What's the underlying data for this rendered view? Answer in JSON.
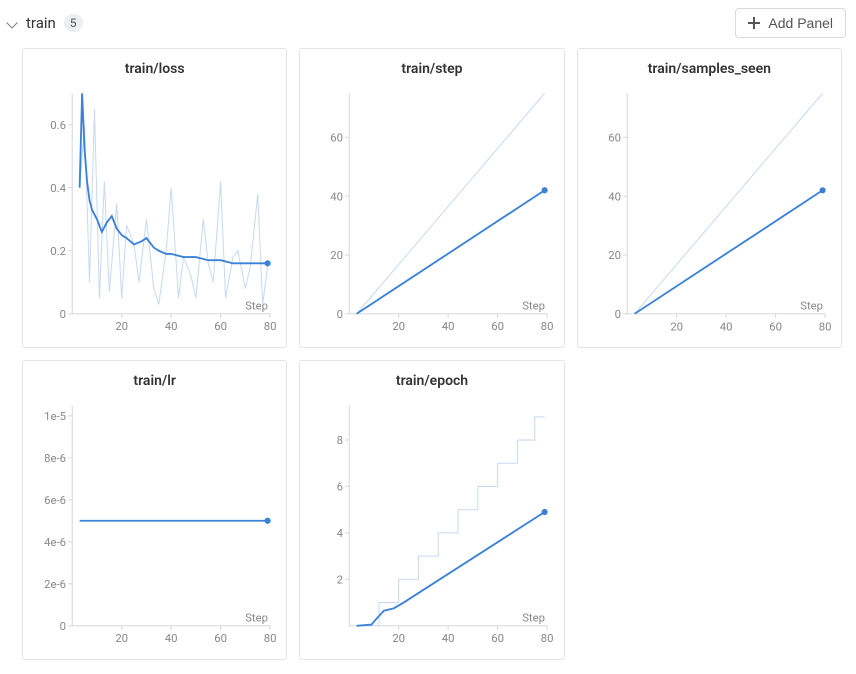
{
  "section": {
    "title": "train",
    "count": "5",
    "add_panel_label": "Add Panel"
  },
  "panels": [
    {
      "title": "train/loss"
    },
    {
      "title": "train/step"
    },
    {
      "title": "train/samples_seen"
    },
    {
      "title": "train/lr"
    },
    {
      "title": "train/epoch"
    }
  ],
  "chart_data": [
    {
      "type": "line",
      "title": "train/loss",
      "xlabel": "Step",
      "ylabel": "",
      "xlim": [
        0,
        80
      ],
      "ylim": [
        0,
        0.7
      ],
      "x_ticks": [
        20,
        40,
        60,
        80
      ],
      "y_ticks": [
        0,
        0.2,
        0.4,
        0.6
      ],
      "series": [
        {
          "name": "raw",
          "role": "ghost",
          "x": [
            3,
            5,
            7,
            9,
            11,
            13,
            15,
            18,
            20,
            22,
            25,
            27,
            30,
            33,
            35,
            38,
            40,
            43,
            45,
            48,
            50,
            53,
            55,
            57,
            60,
            62,
            65,
            67,
            70,
            72,
            75,
            77,
            79
          ],
          "values": [
            0.4,
            0.6,
            0.1,
            0.65,
            0.05,
            0.42,
            0.07,
            0.35,
            0.05,
            0.28,
            0.22,
            0.1,
            0.3,
            0.08,
            0.03,
            0.2,
            0.4,
            0.05,
            0.18,
            0.12,
            0.05,
            0.3,
            0.16,
            0.1,
            0.42,
            0.05,
            0.18,
            0.2,
            0.08,
            0.15,
            0.38,
            0.03,
            0.15
          ]
        },
        {
          "name": "smoothed",
          "role": "main",
          "x": [
            3,
            4,
            5,
            6,
            7,
            8,
            10,
            12,
            14,
            16,
            18,
            20,
            22,
            25,
            28,
            30,
            33,
            35,
            38,
            40,
            45,
            50,
            55,
            60,
            65,
            70,
            75,
            79
          ],
          "values": [
            0.4,
            0.7,
            0.52,
            0.42,
            0.36,
            0.33,
            0.3,
            0.26,
            0.29,
            0.31,
            0.27,
            0.25,
            0.24,
            0.22,
            0.23,
            0.24,
            0.21,
            0.2,
            0.19,
            0.19,
            0.18,
            0.18,
            0.17,
            0.17,
            0.16,
            0.16,
            0.16,
            0.16
          ]
        }
      ]
    },
    {
      "type": "line",
      "title": "train/step",
      "xlabel": "Step",
      "ylabel": "",
      "xlim": [
        0,
        80
      ],
      "ylim": [
        0,
        75
      ],
      "x_ticks": [
        20,
        40,
        60,
        80
      ],
      "y_ticks": [
        0,
        20,
        40,
        60
      ],
      "series": [
        {
          "name": "ghost",
          "role": "ghost",
          "x": [
            3,
            79
          ],
          "values": [
            0,
            75
          ]
        },
        {
          "name": "main",
          "role": "main",
          "x": [
            3,
            79
          ],
          "values": [
            0,
            42
          ]
        }
      ]
    },
    {
      "type": "line",
      "title": "train/samples_seen",
      "xlabel": "Step",
      "ylabel": "",
      "xlim": [
        0,
        80
      ],
      "ylim": [
        0,
        75
      ],
      "x_ticks": [
        20,
        40,
        60,
        80
      ],
      "y_ticks": [
        0,
        20,
        40,
        60
      ],
      "series": [
        {
          "name": "ghost",
          "role": "ghost",
          "x": [
            3,
            79
          ],
          "values": [
            0,
            75
          ]
        },
        {
          "name": "main",
          "role": "main",
          "x": [
            3,
            79
          ],
          "values": [
            0,
            42
          ]
        }
      ]
    },
    {
      "type": "line",
      "title": "train/lr",
      "xlabel": "Step",
      "ylabel": "",
      "xlim": [
        0,
        80
      ],
      "ylim": [
        0,
        1.05e-05
      ],
      "y_tick_labels": [
        "0",
        "2e-6",
        "4e-6",
        "6e-6",
        "8e-6",
        "1e-5"
      ],
      "x_ticks": [
        20,
        40,
        60,
        80
      ],
      "y_ticks": [
        0,
        2e-06,
        4e-06,
        6e-06,
        8e-06,
        1e-05
      ],
      "series": [
        {
          "name": "main",
          "role": "main",
          "x": [
            3,
            79
          ],
          "values": [
            5e-06,
            5e-06
          ]
        }
      ]
    },
    {
      "type": "line",
      "title": "train/epoch",
      "xlabel": "Step",
      "ylabel": "",
      "xlim": [
        0,
        80
      ],
      "ylim": [
        0,
        9.5
      ],
      "x_ticks": [
        20,
        40,
        60,
        80
      ],
      "y_ticks": [
        2,
        4,
        6,
        8
      ],
      "series": [
        {
          "name": "ghost",
          "role": "ghost",
          "step_like": true,
          "x": [
            3,
            12,
            20,
            28,
            36,
            44,
            52,
            60,
            68,
            75,
            79
          ],
          "values": [
            0,
            1,
            2,
            3,
            4,
            5,
            6,
            7,
            8,
            9,
            9
          ]
        },
        {
          "name": "main",
          "role": "main",
          "x": [
            3,
            9,
            11,
            14,
            18,
            22,
            79
          ],
          "values": [
            0.0,
            0.05,
            0.3,
            0.65,
            0.75,
            1.0,
            4.9
          ]
        }
      ]
    }
  ]
}
